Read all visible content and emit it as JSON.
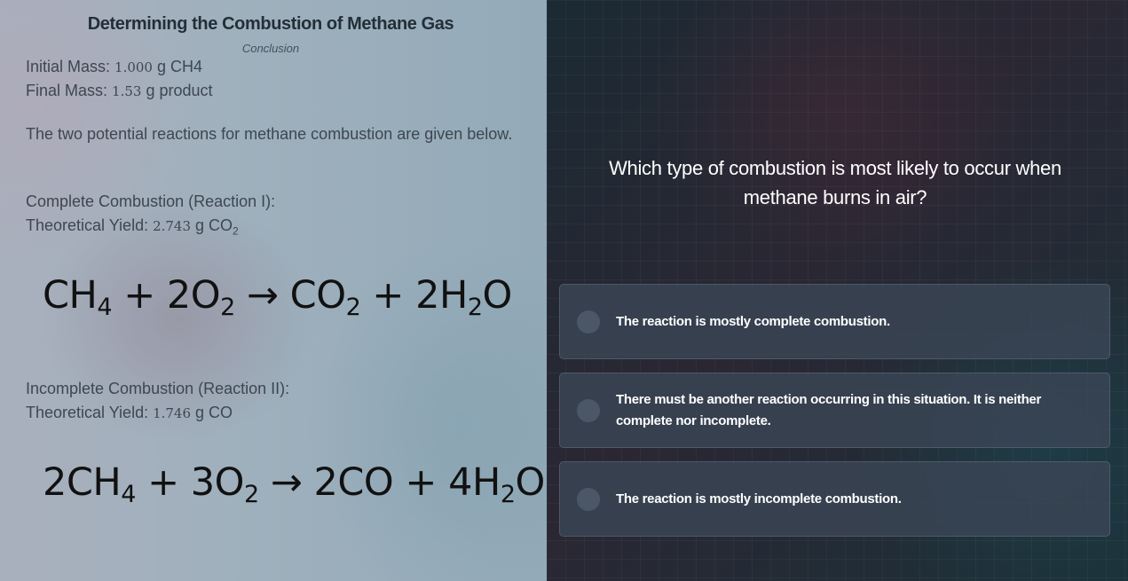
{
  "left": {
    "title": "Determining the Combustion of Methane Gas",
    "subtitle": "Conclusion",
    "initial_mass_label": "Initial Mass: ",
    "initial_mass_value": "1.000",
    "initial_mass_unit": " g CH4",
    "final_mass_label": "Final Mass: ",
    "final_mass_value": "1.53",
    "final_mass_unit": " g product",
    "intro": "The two potential reactions for methane combustion are given below.",
    "complete": {
      "heading": "Complete Combustion (Reaction I):",
      "yield_label": "Theoretical Yield: ",
      "yield_value": "2.743",
      "yield_unit": " g CO",
      "yield_sub": "2"
    },
    "incomplete": {
      "heading": "Incomplete Combustion (Reaction II):",
      "yield_label": "Theoretical Yield: ",
      "yield_value": "1.746",
      "yield_unit": " g CO"
    },
    "equation1": {
      "t1": "CH",
      "s1": "4",
      "t2": " + 2O",
      "s2": "2",
      "t3": " → CO",
      "s3": "2",
      "t4": " + 2H",
      "s4": "2",
      "t5": "O"
    },
    "equation2": {
      "t1": "2CH",
      "s1": "4",
      "t2": " + 3O",
      "s2": "2",
      "t3": " → 2CO + 4H",
      "s3": "2",
      "t4": "O"
    }
  },
  "right": {
    "question": "Which type of combustion is most likely to occur when methane burns in air?",
    "options": [
      {
        "label": "The reaction is mostly complete combustion."
      },
      {
        "label": "There must be another reaction occurring in this situation. It is neither complete nor incomplete."
      },
      {
        "label": "The reaction is mostly incomplete combustion."
      }
    ]
  },
  "colors": {
    "option_bg": "#3a4656",
    "radio": "#4b5767",
    "question_text": "#ffffff"
  }
}
